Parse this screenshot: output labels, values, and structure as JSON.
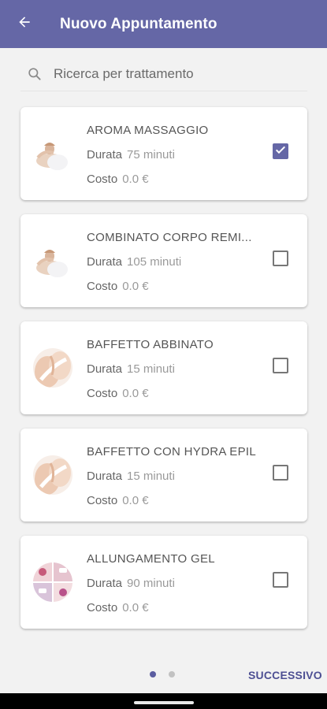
{
  "appbar": {
    "title": "Nuovo Appuntamento",
    "back_icon": "arrow-left-icon",
    "background": "#6567a6"
  },
  "search": {
    "icon": "search-icon",
    "placeholder": "Ricerca per trattamento",
    "value": ""
  },
  "treatments": [
    {
      "name": "AROMA MASSAGGIO",
      "duration_label": "Durata",
      "duration": "75 minuti",
      "cost_label": "Costo",
      "cost": "0.0 €",
      "checked": true,
      "image": "massage-thumbnail"
    },
    {
      "name": "COMBINATO CORPO REMI...",
      "duration_label": "Durata",
      "duration": "105 minuti",
      "cost_label": "Costo",
      "cost": "0.0 €",
      "checked": false,
      "image": "massage-thumbnail"
    },
    {
      "name": "BAFFETTO ABBINATO",
      "duration_label": "Durata",
      "duration": "15 minuti",
      "cost_label": "Costo",
      "cost": "0.0 €",
      "checked": false,
      "image": "skin-care-thumbnail"
    },
    {
      "name": "BAFFETTO CON HYDRA EPIL",
      "duration_label": "Durata",
      "duration": "15 minuti",
      "cost_label": "Costo",
      "cost": "0.0 €",
      "checked": false,
      "image": "skin-care-thumbnail"
    },
    {
      "name": "ALLUNGAMENTO GEL",
      "duration_label": "Durata",
      "duration": "90 minuti",
      "cost_label": "Costo",
      "cost": "0.0 €",
      "checked": false,
      "image": "nails-collage-thumbnail"
    }
  ],
  "pager": {
    "count": 2,
    "active": 1
  },
  "footer": {
    "next_label": "SUCCESSIVO"
  },
  "colors": {
    "accent": "#6567a6",
    "next_text": "#4d4f93",
    "background": "#f2f2f2"
  }
}
